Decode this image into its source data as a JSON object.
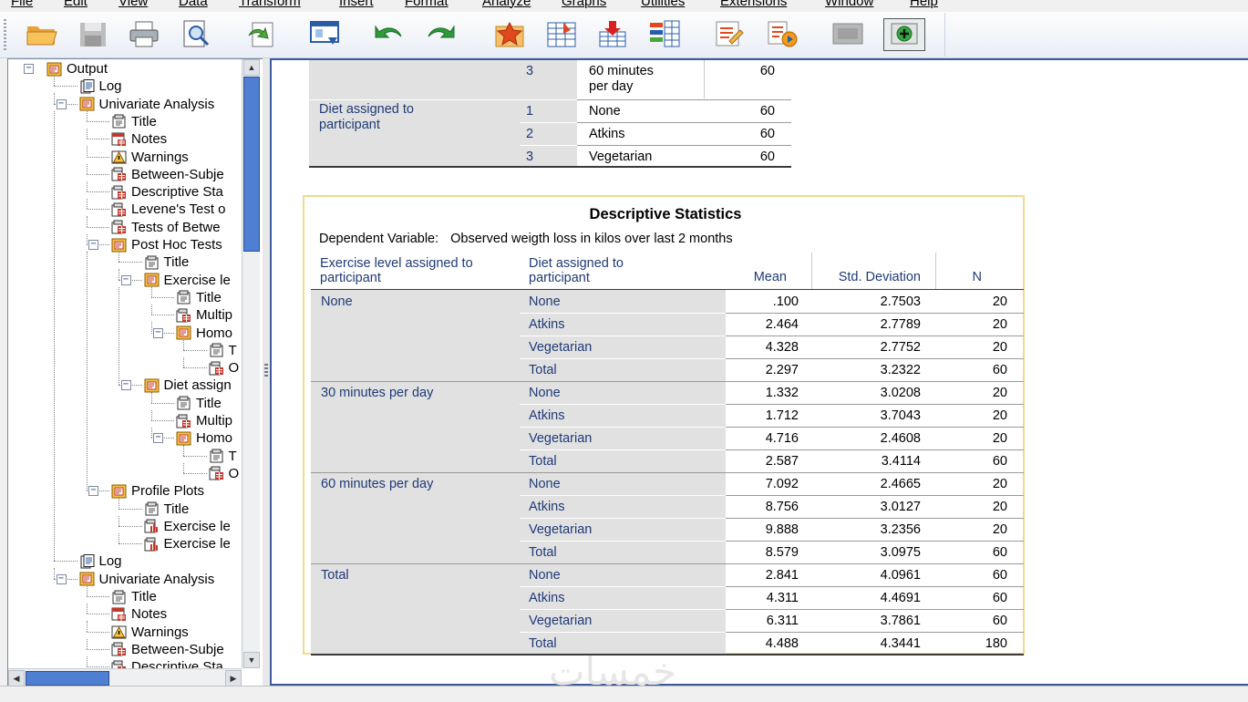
{
  "menubar": [
    "File",
    "Edit",
    "View",
    "Data",
    "Transform",
    "Insert",
    "Format",
    "Analyze",
    "Graphs",
    "Utilities",
    "Extensions",
    "Window",
    "Help"
  ],
  "toolbar": [
    "open-icon",
    "save-icon",
    "print-icon",
    "print-preview-icon",
    "export-icon",
    "recall-dialog-icon",
    "undo-icon",
    "redo-icon",
    "goto-data-icon",
    "goto-variable-icon",
    "insert-cases-icon",
    "split-file-icon",
    "designate-window-icon",
    "run-script-icon",
    "toggle-pane-icon",
    "add-output-icon"
  ],
  "outline": [
    {
      "level": 0,
      "label": "Output",
      "icon": "output",
      "expander": "minus"
    },
    {
      "level": 1,
      "label": "Log",
      "icon": "log"
    },
    {
      "level": 1,
      "label": "Univariate Analysis",
      "icon": "group",
      "expander": "minus"
    },
    {
      "level": 2,
      "label": "Title",
      "icon": "title"
    },
    {
      "level": 2,
      "label": "Notes",
      "icon": "notes"
    },
    {
      "level": 2,
      "label": "Warnings",
      "icon": "warning"
    },
    {
      "level": 2,
      "label": "Between-Subje",
      "icon": "table"
    },
    {
      "level": 2,
      "label": "Descriptive Sta",
      "icon": "table"
    },
    {
      "level": 2,
      "label": "Levene's Test o",
      "icon": "table"
    },
    {
      "level": 2,
      "label": "Tests of Betwe",
      "icon": "table"
    },
    {
      "level": 2,
      "label": "Post Hoc Tests",
      "icon": "group",
      "expander": "minus"
    },
    {
      "level": 3,
      "label": "Title",
      "icon": "title"
    },
    {
      "level": 3,
      "label": "Exercise le",
      "icon": "group",
      "expander": "minus"
    },
    {
      "level": 4,
      "label": "Title",
      "icon": "title"
    },
    {
      "level": 4,
      "label": "Multip",
      "icon": "table"
    },
    {
      "level": 4,
      "label": "Homo",
      "icon": "group",
      "expander": "minus"
    },
    {
      "level": 5,
      "label": "T",
      "icon": "title"
    },
    {
      "level": 5,
      "label": "O",
      "icon": "table"
    },
    {
      "level": 3,
      "label": "Diet assign",
      "icon": "group",
      "expander": "minus"
    },
    {
      "level": 4,
      "label": "Title",
      "icon": "title"
    },
    {
      "level": 4,
      "label": "Multip",
      "icon": "table"
    },
    {
      "level": 4,
      "label": "Homo",
      "icon": "group",
      "expander": "minus"
    },
    {
      "level": 5,
      "label": "T",
      "icon": "title"
    },
    {
      "level": 5,
      "label": "O",
      "icon": "table"
    },
    {
      "level": 2,
      "label": "Profile Plots",
      "icon": "group",
      "expander": "minus"
    },
    {
      "level": 3,
      "label": "Title",
      "icon": "title"
    },
    {
      "level": 3,
      "label": "Exercise le",
      "icon": "chart"
    },
    {
      "level": 3,
      "label": "Exercise le",
      "icon": "chart"
    },
    {
      "level": 1,
      "label": "Log",
      "icon": "log"
    },
    {
      "level": 1,
      "label": "Univariate Analysis",
      "icon": "group",
      "expander": "minus"
    },
    {
      "level": 2,
      "label": "Title",
      "icon": "title"
    },
    {
      "level": 2,
      "label": "Notes",
      "icon": "notes"
    },
    {
      "level": 2,
      "label": "Warnings",
      "icon": "warning"
    },
    {
      "level": 2,
      "label": "Between-Subje",
      "icon": "table"
    },
    {
      "level": 2,
      "label": "Descriptive Sta",
      "icon": "table"
    }
  ],
  "between_subjects_partial": {
    "rows": [
      {
        "factor": "",
        "value": "3",
        "label": "60 minutes per day",
        "n": "60"
      },
      {
        "factor": "Diet assigned to participant",
        "value": "1",
        "label": "None",
        "n": "60"
      },
      {
        "factor": "",
        "value": "2",
        "label": "Atkins",
        "n": "60"
      },
      {
        "factor": "",
        "value": "3",
        "label": "Vegetarian",
        "n": "60"
      }
    ]
  },
  "descriptive": {
    "title": "Descriptive Statistics",
    "dependent_label": "Dependent Variable:",
    "dependent_value": "Observed weigth loss in kilos over last 2 months",
    "headers": {
      "exercise": "Exercise level assigned to participant",
      "diet": "Diet assigned to participant",
      "mean": "Mean",
      "sd": "Std. Deviation",
      "n": "N"
    },
    "groups": [
      {
        "exercise": "None",
        "rows": [
          {
            "diet": "None",
            "mean": ".100",
            "sd": "2.7503",
            "n": "20"
          },
          {
            "diet": "Atkins",
            "mean": "2.464",
            "sd": "2.7789",
            "n": "20"
          },
          {
            "diet": "Vegetarian",
            "mean": "4.328",
            "sd": "2.7752",
            "n": "20"
          },
          {
            "diet": "Total",
            "mean": "2.297",
            "sd": "3.2322",
            "n": "60"
          }
        ]
      },
      {
        "exercise": "30 minutes per day",
        "rows": [
          {
            "diet": "None",
            "mean": "1.332",
            "sd": "3.0208",
            "n": "20"
          },
          {
            "diet": "Atkins",
            "mean": "1.712",
            "sd": "3.7043",
            "n": "20"
          },
          {
            "diet": "Vegetarian",
            "mean": "4.716",
            "sd": "2.4608",
            "n": "20"
          },
          {
            "diet": "Total",
            "mean": "2.587",
            "sd": "3.4114",
            "n": "60"
          }
        ]
      },
      {
        "exercise": "60 minutes per day",
        "rows": [
          {
            "diet": "None",
            "mean": "7.092",
            "sd": "2.4665",
            "n": "20"
          },
          {
            "diet": "Atkins",
            "mean": "8.756",
            "sd": "3.0127",
            "n": "20"
          },
          {
            "diet": "Vegetarian",
            "mean": "9.888",
            "sd": "3.2356",
            "n": "20"
          },
          {
            "diet": "Total",
            "mean": "8.579",
            "sd": "3.0975",
            "n": "60"
          }
        ]
      },
      {
        "exercise": "Total",
        "rows": [
          {
            "diet": "None",
            "mean": "2.841",
            "sd": "4.0961",
            "n": "60"
          },
          {
            "diet": "Atkins",
            "mean": "4.311",
            "sd": "4.4691",
            "n": "60"
          },
          {
            "diet": "Vegetarian",
            "mean": "6.311",
            "sd": "3.7861",
            "n": "60"
          },
          {
            "diet": "Total",
            "mean": "4.488",
            "sd": "4.3441",
            "n": "180"
          }
        ]
      }
    ]
  },
  "watermark": "خمسات",
  "colors": {
    "label_blue": "#1f3a77",
    "selection_border": "#f3d98d",
    "row_shade": "#e1e1e1",
    "scroll_thumb": "#4f7fd0"
  }
}
